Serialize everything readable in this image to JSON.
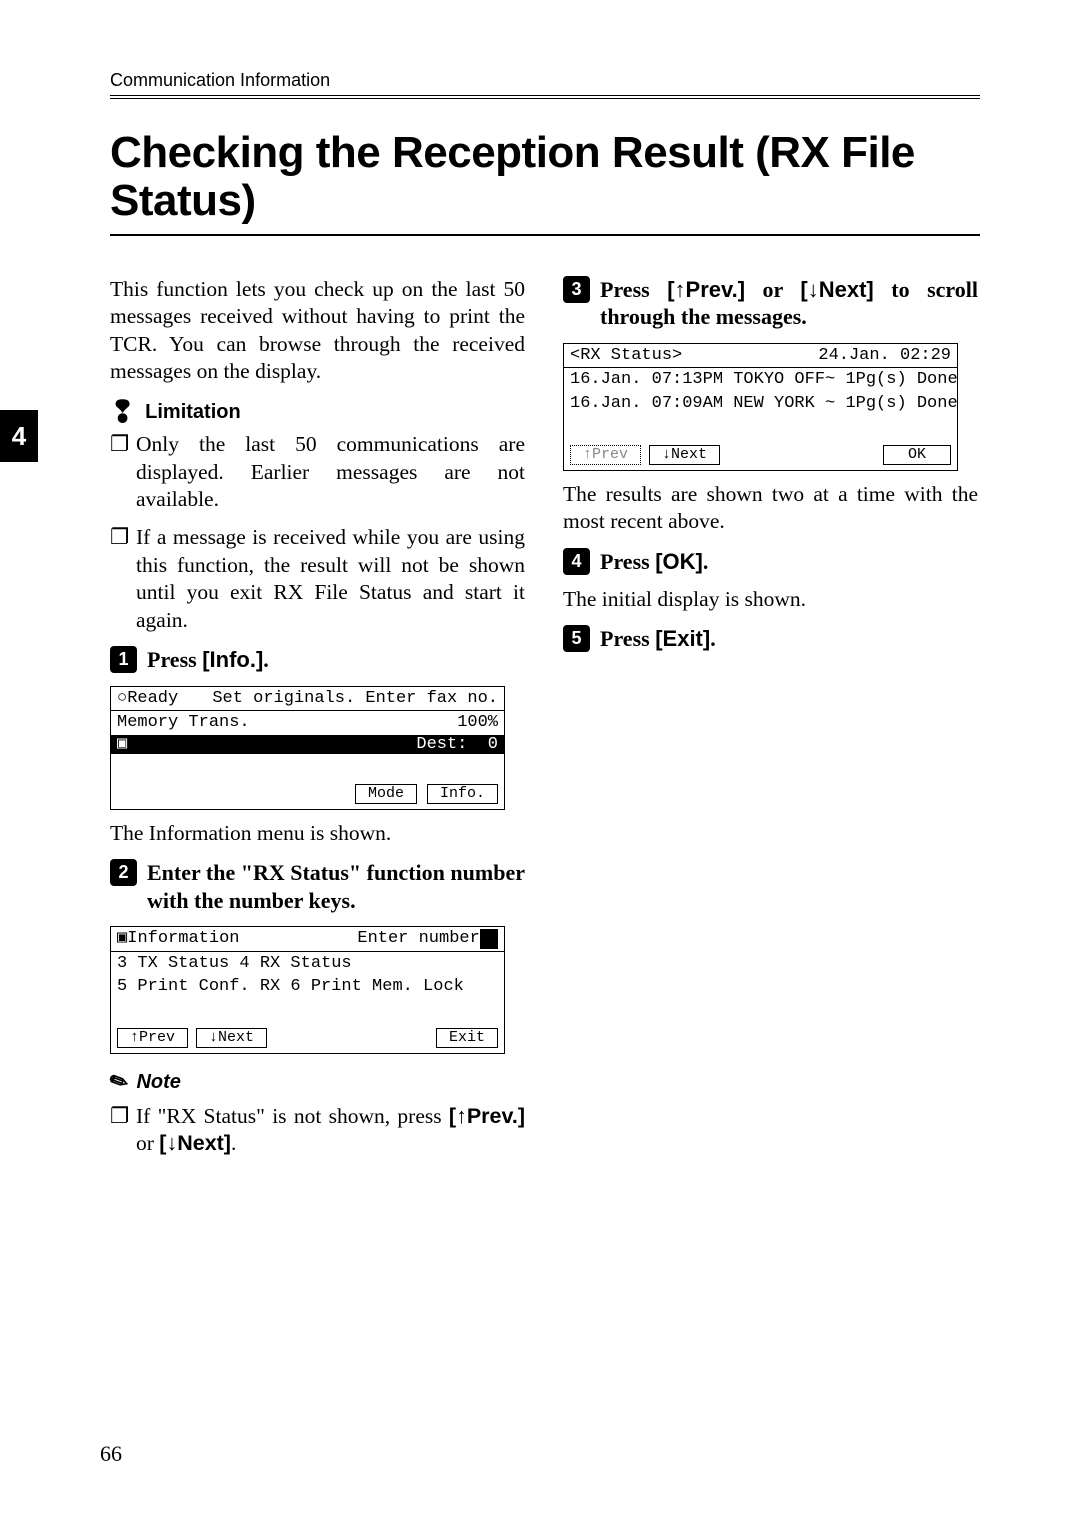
{
  "header": "Communication Information",
  "title": "Checking the Reception Result (RX File Status)",
  "side_tab": "4",
  "page_number": "66",
  "intro": "This function lets you check up on the last 50 messages received without having to print the TCR. You can browse through the received messages on the display.",
  "limitation": {
    "heading": "Limitation",
    "items": [
      "Only the last 50 communications are displayed. Earlier messages are not available.",
      "If a message is received while you are using this function, the result will not be shown until you exit RX File Status and start it again."
    ]
  },
  "steps": {
    "s1": {
      "num": "1",
      "text_plain": "Press ",
      "text_sans": "[Info.]",
      "tail": "."
    },
    "s2": {
      "num": "2",
      "text": "Enter the \"RX Status\" function number with the number keys."
    },
    "s3": {
      "num": "3",
      "pre": "Press ",
      "btn1": "[↑Prev.]",
      "mid": " or ",
      "btn2": "[↓Next]",
      "post": " to scroll through the messages."
    },
    "s4": {
      "num": "4",
      "text_plain": "Press ",
      "text_sans": "[OK]",
      "tail": "."
    },
    "s5": {
      "num": "5",
      "text_plain": "Press ",
      "text_sans": "[Exit]",
      "tail": "."
    }
  },
  "lcd1": {
    "line1a": "Ready",
    "line1b": "Set originals. Enter fax no.",
    "line2a": "Memory Trans.",
    "line2b": "100%",
    "line3a": "Dest:",
    "line3b": "0",
    "btn_mode": "Mode",
    "btn_info": "Info."
  },
  "lcd1_caption": "The Information menu is shown.",
  "lcd2": {
    "line1a": "Information",
    "line1b": "Enter number",
    "line2": "3 TX Status      4 RX Status",
    "line3": "5 Print Conf. RX  6 Print Mem. Lock",
    "btn_prev": "↑Prev",
    "btn_next": "↓Next",
    "btn_exit": "Exit"
  },
  "note": {
    "heading": "Note",
    "text_pre": "If \"RX Status\" is not shown, press ",
    "btn1": "[↑Prev.]",
    "mid": " or ",
    "btn2": "[↓Next]",
    "tail": "."
  },
  "lcd3": {
    "title": "<RX Status>",
    "date": "24.Jan. 02:29",
    "row1": "16.Jan. 07:13PM TOKYO OFF~ 1Pg(s)  Done",
    "row2": "16.Jan. 07:09AM NEW YORK ~ 1Pg(s)  Done",
    "btn_prev": "↑Prev",
    "btn_next": "↓Next",
    "btn_ok": "OK"
  },
  "lcd3_caption": "The results are shown two at a time with the most recent above.",
  "s4_caption": "The initial display is shown."
}
